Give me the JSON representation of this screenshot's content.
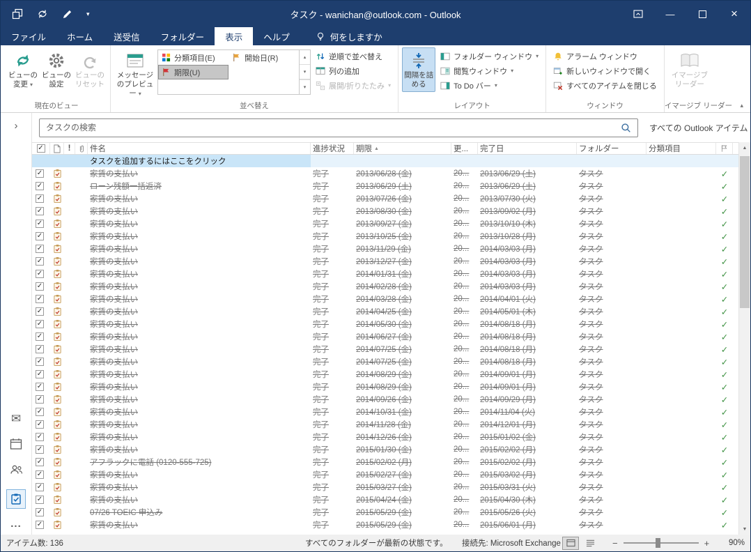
{
  "titlebar": {
    "title": "タスク - wanichan@outlook.com  -  Outlook"
  },
  "tabs": {
    "file": "ファイル",
    "home": "ホーム",
    "send_receive": "送受信",
    "folder": "フォルダー",
    "view": "表示",
    "help": "ヘルプ",
    "tell_me": "何をしますか"
  },
  "ribbon": {
    "current_view": {
      "group_label": "現在のビュー",
      "change_view": "ビューの変更",
      "view_settings": "ビューの設定",
      "reset_view": "ビューのリセット"
    },
    "arrangement": {
      "group_label": "並べ替え",
      "message_preview": "メッセージのプレビュー",
      "gallery": [
        {
          "label": "分類項目(E)"
        },
        {
          "label": "開始日(R)"
        },
        {
          "label": "期限(U)"
        }
      ],
      "reverse_sort": "逆順で並べ替え",
      "add_columns": "列の追加",
      "expand_collapse": "展開/折りたたみ"
    },
    "layout": {
      "group_label": "レイアウト",
      "tighter_spacing": "間隔を詰める",
      "folder_pane": "フォルダー ウィンドウ",
      "reading_pane": "閲覧ウィンドウ",
      "todo_bar": "To Do バー"
    },
    "window": {
      "group_label": "ウィンドウ",
      "reminders_window": "アラーム ウィンドウ",
      "open_new_window": "新しいウィンドウで開く",
      "close_all_items": "すべてのアイテムを閉じる"
    },
    "immersive": {
      "group_label": "イマージブ リーダー",
      "immersive_reader": "イマージブ リーダー"
    }
  },
  "search": {
    "placeholder": "タスクの検索",
    "scope": "すべての Outlook アイテム"
  },
  "task_list": {
    "headers": {
      "importance": "!",
      "subject": "件名",
      "progress": "進捗状況",
      "due_date": "期限",
      "modified": "更...",
      "completed_date": "完了日",
      "folder": "フォルダー",
      "categories": "分類項目"
    },
    "add_row_text": "タスクを追加するにはここをクリック",
    "row_defaults": {
      "progress": "完了",
      "modified": "20...",
      "folder": "タスク"
    },
    "rows": [
      {
        "subject": "家賃の支払い",
        "due": "2013/06/28 (金)",
        "completed": "2013/06/29 (土)"
      },
      {
        "subject": "ローン残額一括返済",
        "due": "2013/06/29 (土)",
        "completed": "2013/06/29 (土)"
      },
      {
        "subject": "家賃の支払い",
        "due": "2013/07/26 (金)",
        "completed": "2013/07/30 (火)"
      },
      {
        "subject": "家賃の支払い",
        "due": "2013/08/30 (金)",
        "completed": "2013/09/02 (月)"
      },
      {
        "subject": "家賃の支払い",
        "due": "2013/09/27 (金)",
        "completed": "2013/10/10 (木)"
      },
      {
        "subject": "家賃の支払い",
        "due": "2013/10/25 (金)",
        "completed": "2013/10/28 (月)"
      },
      {
        "subject": "家賃の支払い",
        "due": "2013/11/29 (金)",
        "completed": "2014/03/03 (月)"
      },
      {
        "subject": "家賃の支払い",
        "due": "2013/12/27 (金)",
        "completed": "2014/03/03 (月)"
      },
      {
        "subject": "家賃の支払い",
        "due": "2014/01/31 (金)",
        "completed": "2014/03/03 (月)"
      },
      {
        "subject": "家賃の支払い",
        "due": "2014/02/28 (金)",
        "completed": "2014/03/03 (月)"
      },
      {
        "subject": "家賃の支払い",
        "due": "2014/03/28 (金)",
        "completed": "2014/04/01 (火)"
      },
      {
        "subject": "家賃の支払い",
        "due": "2014/04/25 (金)",
        "completed": "2014/05/01 (木)"
      },
      {
        "subject": "家賃の支払い",
        "due": "2014/05/30 (金)",
        "completed": "2014/08/18 (月)"
      },
      {
        "subject": "家賃の支払い",
        "due": "2014/06/27 (金)",
        "completed": "2014/08/18 (月)"
      },
      {
        "subject": "家賃の支払い",
        "due": "2014/07/25 (金)",
        "completed": "2014/08/18 (月)"
      },
      {
        "subject": "家賃の支払い",
        "due": "2014/07/25 (金)",
        "completed": "2014/08/18 (月)"
      },
      {
        "subject": "家賃の支払い",
        "due": "2014/08/29 (金)",
        "completed": "2014/09/01 (月)"
      },
      {
        "subject": "家賃の支払い",
        "due": "2014/08/29 (金)",
        "completed": "2014/09/01 (月)"
      },
      {
        "subject": "家賃の支払い",
        "due": "2014/09/26 (金)",
        "completed": "2014/09/29 (月)"
      },
      {
        "subject": "家賃の支払い",
        "due": "2014/10/31 (金)",
        "completed": "2014/11/04 (火)"
      },
      {
        "subject": "家賃の支払い",
        "due": "2014/11/28 (金)",
        "completed": "2014/12/01 (月)"
      },
      {
        "subject": "家賃の支払い",
        "due": "2014/12/26 (金)",
        "completed": "2015/01/02 (金)"
      },
      {
        "subject": "家賃の支払い",
        "due": "2015/01/30 (金)",
        "completed": "2015/02/02 (月)"
      },
      {
        "subject": "アフラックに電話 (0120-555-725)",
        "due": "2015/02/02 (月)",
        "completed": "2015/02/02 (月)"
      },
      {
        "subject": "家賃の支払い",
        "due": "2015/02/27 (金)",
        "completed": "2015/03/02 (月)"
      },
      {
        "subject": "家賃の支払い",
        "due": "2015/03/27 (金)",
        "completed": "2015/03/31 (火)"
      },
      {
        "subject": "家賃の支払い",
        "due": "2015/04/24 (金)",
        "completed": "2015/04/30 (木)"
      },
      {
        "subject": "07/26 TOEIC 申込み",
        "due": "2015/05/29 (金)",
        "completed": "2015/05/26 (火)"
      },
      {
        "subject": "家賃の支払い",
        "due": "2015/05/29 (金)",
        "completed": "2015/06/01 (月)"
      }
    ]
  },
  "status_bar": {
    "item_count": "アイテム数: 136",
    "sync_status": "すべてのフォルダーが最新の状態です。",
    "connection": "接続先: Microsoft Exchange",
    "zoom_level": "90%"
  },
  "icons": {
    "dropdown": "▾",
    "collapse_ribbon": "▴",
    "sort_ascending": "▲",
    "checkbox_check": "✓",
    "completed_check": "✓",
    "expand_rail": "›",
    "ellipsis": "...",
    "minimize": "—",
    "close": "×",
    "scroll_up": "▲",
    "scroll_down": "▼",
    "zoom_out": "−",
    "zoom_in": "+"
  },
  "colors": {
    "titlebar": "#1e3e6e",
    "accent": "#0f6cbd",
    "completed_text": "#767676",
    "check_green": "#3f9243",
    "selection_blue": "#c9e5f8"
  }
}
